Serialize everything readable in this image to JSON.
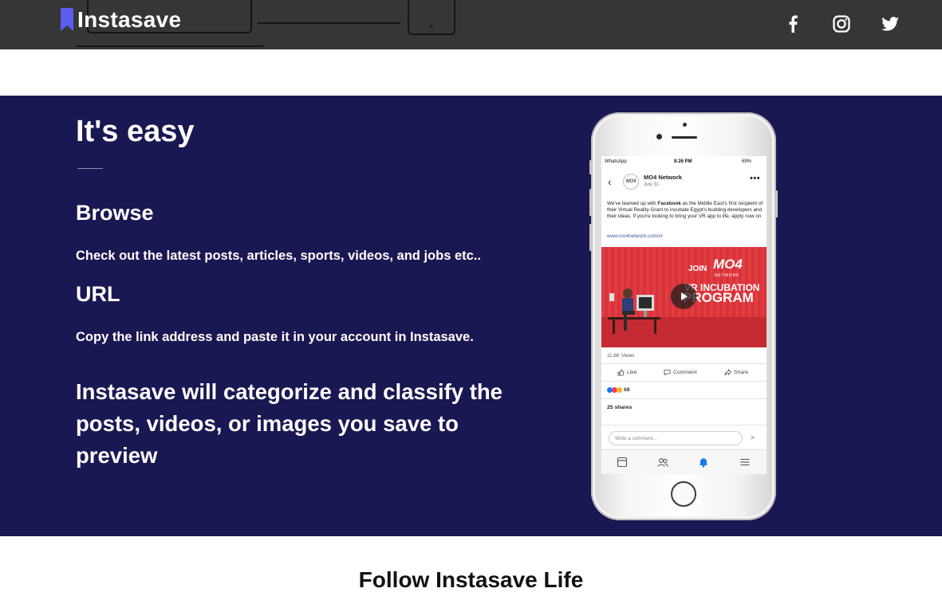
{
  "header": {
    "logo_text": "Instasave",
    "social": [
      "facebook-icon",
      "instagram-icon",
      "twitter-icon"
    ]
  },
  "feature": {
    "title": "It's easy",
    "steps": [
      {
        "title": "Browse",
        "text": "Check out the latest posts, articles, sports, videos, and jobs etc.."
      },
      {
        "title": "URL",
        "text": "Copy the link address and paste it in your account in Instasave."
      }
    ],
    "summary": "Instasave will categorize and classify the posts, videos, or images you save to preview"
  },
  "phone": {
    "status": {
      "carrier": "WhatsApp",
      "time": "8:26 PM",
      "battery": "69%"
    },
    "post": {
      "page_name": "MO4 Network",
      "date": "July 31 ·",
      "avatar_text": "MO4",
      "text_before": "We've teamed up with ",
      "text_bold": "Facebook",
      "text_after": " as the Middle East's first recipient of their Virtual Reality Grant to incubate Egypt's budding developers and their ideas. If you're looking to bring your VR app to life, apply now on",
      "link": "www.mo4network.com/vr",
      "video": {
        "join": "JOIN",
        "brand": "MO4",
        "network": "NETWORK",
        "line1": "VR INCUBATION",
        "line2": "PROGRAM"
      },
      "views": "11.6K Views",
      "actions": {
        "like": "Like",
        "comment": "Comment",
        "share": "Share"
      },
      "reactions": "68",
      "shares": "25 shares",
      "comment_placeholder": "Write a comment..."
    }
  },
  "follow": {
    "title": "Follow Instasave Life"
  },
  "colors": {
    "header_bg": "#363636",
    "feature_bg": "#1a1852",
    "logo_accent": "#5b5cf0",
    "video_red": "#e23c42"
  }
}
